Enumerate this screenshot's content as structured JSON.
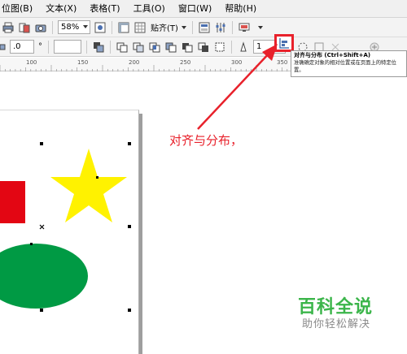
{
  "menubar": {
    "items": [
      {
        "label": "位图(B)"
      },
      {
        "label": "文本(X)"
      },
      {
        "label": "表格(T)"
      },
      {
        "label": "工具(O)"
      },
      {
        "label": "窗口(W)"
      },
      {
        "label": "帮助(H)"
      }
    ]
  },
  "toolbar": {
    "zoom_value": "58%",
    "snap_label": "贴齐(T)"
  },
  "propertybar": {
    "value_field": ".0",
    "outline_width": "1"
  },
  "ruler": {
    "labels": [
      "100",
      "150",
      "200",
      "250",
      "300",
      "350"
    ]
  },
  "tooltip": {
    "title": "对齐与分布 (Ctrl+Shift+A)",
    "description": "准确确定对象的相对位置或在页面上的特定位置。"
  },
  "annotation": {
    "text": "对齐与分布，"
  },
  "watermark": {
    "title": "百科全说",
    "subtitle": "助你轻松解决"
  },
  "colors": {
    "highlight": "#e8212b",
    "annotation_text": "#e8212b",
    "star_fill": "#fff200",
    "rectangle_fill": "#e30613",
    "ellipse_fill": "#009a44",
    "watermark_green": "#3bb54a",
    "watermark_gray": "#8a8a8a"
  },
  "icons": {
    "align_distribute": "align-distribute-icon"
  }
}
